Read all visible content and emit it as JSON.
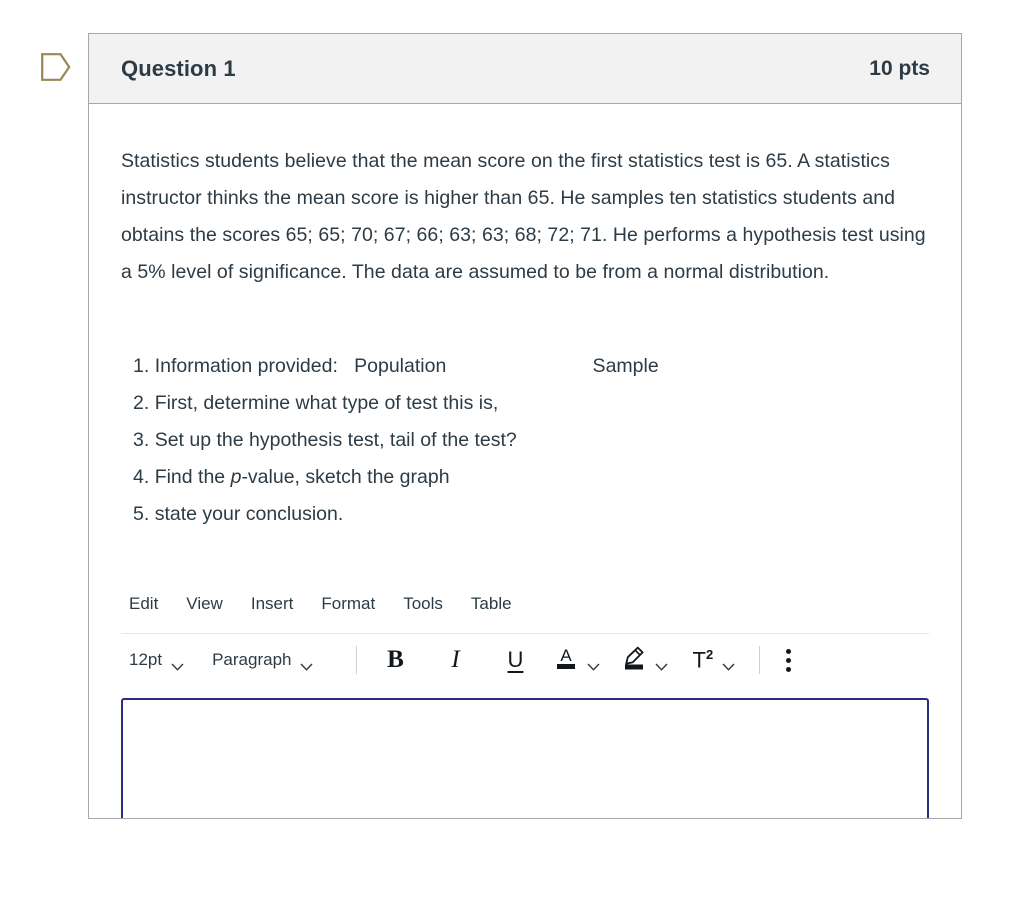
{
  "flag": {
    "icon": "bookmark-flag-icon",
    "color": "#9b8654"
  },
  "card": {
    "header": {
      "title": "Question 1",
      "points": "10 pts"
    },
    "prompt": "Statistics students believe that the mean score on the first statistics test is 65. A statistics instructor thinks the mean score is higher than 65. He samples ten statistics students and obtains the scores 65; 65; 70; 67; 66; 63; 63; 68; 72; 71. He performs a hypothesis test using a 5% level of significance. The data are assumed to be from a normal distribution.",
    "steps": [
      {
        "number": "1.",
        "text": "Information provided:   Population                           Sample"
      },
      {
        "number": "2.",
        "text": "First, determine what type of test this is,"
      },
      {
        "number": "3.",
        "text": "Set up the hypothesis test, tail of the test?"
      },
      {
        "number": "4.",
        "pre": "Find the ",
        "italic": "p",
        "post": "-value, sketch the graph"
      },
      {
        "number": "5.",
        "text": "state your conclusion."
      }
    ]
  },
  "editor": {
    "menubar": [
      {
        "label": "Edit"
      },
      {
        "label": "View"
      },
      {
        "label": "Insert"
      },
      {
        "label": "Format"
      },
      {
        "label": "Tools"
      },
      {
        "label": "Table"
      }
    ],
    "toolbar": {
      "font_size": "12pt",
      "block_format": "Paragraph",
      "bold_label": "B",
      "italic_label": "I",
      "underline_label": "U",
      "text_color_label": "A",
      "superscript_label": "T",
      "superscript_exponent": "2",
      "icons": {
        "chevron": "chevron-down-icon",
        "text_color": "text-color-icon",
        "highlighter": "highlighter-icon",
        "kebab": "more-options-icon"
      }
    },
    "answer": {
      "value": "",
      "placeholder": "",
      "border_color": "#2d2d7f"
    }
  }
}
